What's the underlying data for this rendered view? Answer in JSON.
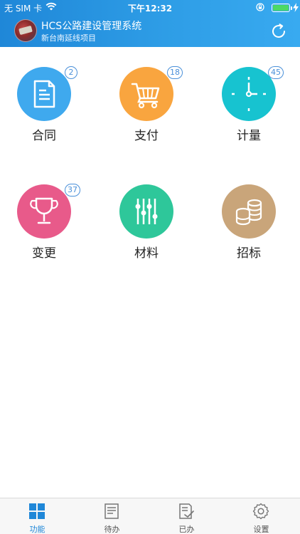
{
  "status": {
    "carrier": "无 SIM 卡",
    "time": "下午12:32"
  },
  "header": {
    "title": "HCS公路建设管理系统",
    "subtitle": "新台南延线项目"
  },
  "modules": [
    {
      "label": "合同",
      "badge": "2",
      "color": "#3fa9ee",
      "icon": "document-icon"
    },
    {
      "label": "支付",
      "badge": "18",
      "color": "#f9a53f",
      "icon": "cart-icon"
    },
    {
      "label": "计量",
      "badge": "45",
      "color": "#17c3d0",
      "icon": "clock-icon"
    },
    {
      "label": "变更",
      "badge": "37",
      "color": "#e85a8a",
      "icon": "trophy-icon"
    },
    {
      "label": "材料",
      "badge": "",
      "color": "#2ec79a",
      "icon": "sliders-icon"
    },
    {
      "label": "招标",
      "badge": "",
      "color": "#c9a57a",
      "icon": "coins-icon"
    }
  ],
  "tabs": [
    {
      "label": "功能",
      "icon": "grid-icon",
      "active": true
    },
    {
      "label": "待办",
      "icon": "todo-icon",
      "active": false
    },
    {
      "label": "已办",
      "icon": "done-icon",
      "active": false
    },
    {
      "label": "设置",
      "icon": "gear-icon",
      "active": false
    }
  ]
}
